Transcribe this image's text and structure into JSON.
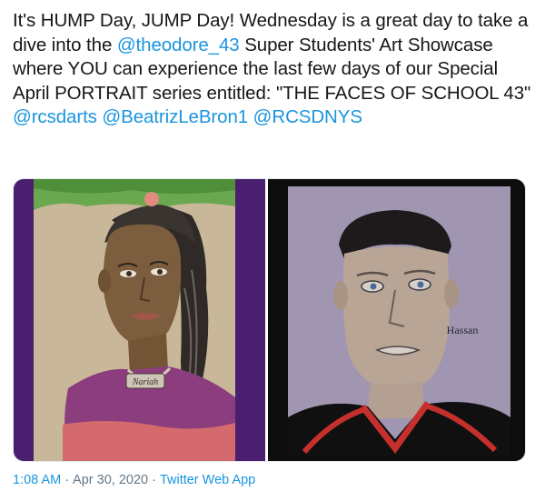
{
  "tweet": {
    "text_parts": {
      "p1": "It's HUMP Day, JUMP Day! Wednesday is a great day to take a dive into the ",
      "mention1": "@theodore_43",
      "p2": " Super Students' Art Showcase where YOU can experience the last few days of our Special April PORTRAIT series entitled: \"THE FACES OF SCHOOL 43\" ",
      "mention2": "@rcsdarts",
      "mention3": "@BeatrizLeBron1",
      "mention4": "@RCSDNYS"
    },
    "media": {
      "left": {
        "name_tag": "Nariah"
      },
      "right": {
        "signature": "Hassan"
      }
    },
    "meta": {
      "time": "1:08 AM",
      "separator": "·",
      "date": "Apr 30, 2020",
      "source": "Twitter Web App"
    },
    "colors": {
      "link": "#1b95e0",
      "text": "#14171a",
      "meta": "#657786"
    }
  }
}
